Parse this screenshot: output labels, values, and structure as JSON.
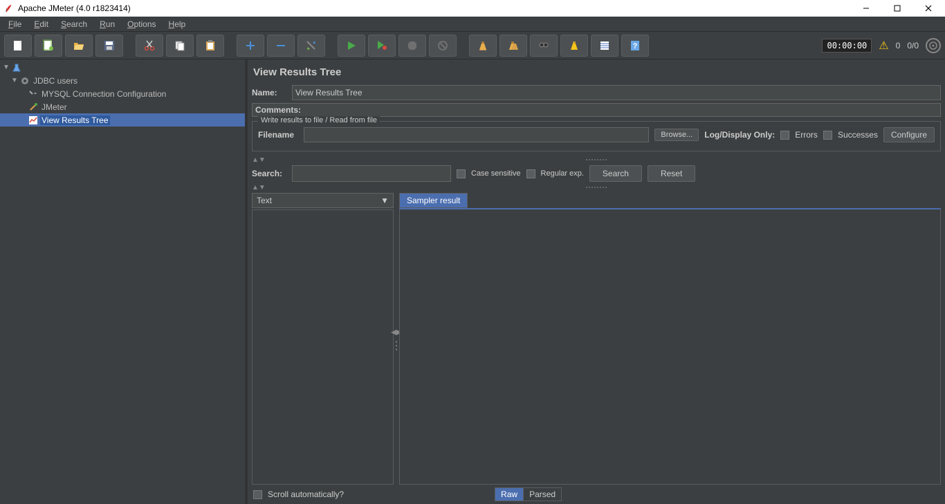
{
  "window": {
    "title": "Apache JMeter (4.0 r1823414)"
  },
  "menu": {
    "file": "File",
    "edit": "Edit",
    "search": "Search",
    "run": "Run",
    "options": "Options",
    "help": "Help"
  },
  "toolbar": {
    "timer": "00:00:00",
    "warn_count": "0",
    "active_threads": "0/0"
  },
  "tree": {
    "root": "",
    "test_plan": "JDBC users",
    "config": "MYSQL Connection Configuration",
    "sampler": "JMeter",
    "listener": "View Results Tree"
  },
  "panel": {
    "title": "View Results Tree",
    "name_label": "Name:",
    "name_value": "View Results Tree",
    "comments_label": "Comments:",
    "fieldset_legend": "Write results to file / Read from file",
    "filename_label": "Filename",
    "browse_btn": "Browse...",
    "logdisplay_label": "Log/Display Only:",
    "errors_label": "Errors",
    "successes_label": "Successes",
    "configure_btn": "Configure",
    "search_label": "Search:",
    "case_sensitive": "Case sensitive",
    "regular_exp": "Regular exp.",
    "search_btn": "Search",
    "reset_btn": "Reset",
    "dropdown_value": "Text",
    "sampler_tab": "Sampler result",
    "scroll_label": "Scroll automatically?",
    "raw_tab": "Raw",
    "parsed_tab": "Parsed"
  }
}
